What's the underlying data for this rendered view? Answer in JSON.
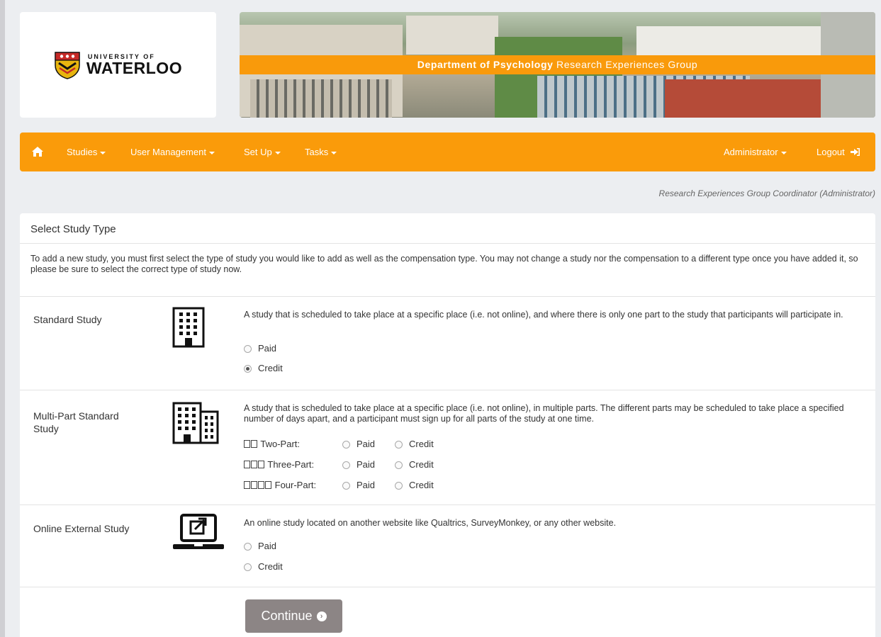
{
  "banner": {
    "logo_small": "UNIVERSITY OF",
    "logo_big": "WATERLOO",
    "dept_bold": "Department of Psychology",
    "dept_rest": " Research Experiences Group"
  },
  "nav": {
    "home_icon": "home-icon",
    "items": [
      "Studies",
      "User Management",
      "Set Up",
      "Tasks"
    ],
    "admin": "Administrator",
    "logout": "Logout"
  },
  "user_line": "Research Experiences Group Coordinator (Administrator)",
  "panel": {
    "title": "Select Study Type",
    "intro": "To add a new study, you must first select the type of study you would like to add as well as the compensation type. You may not change a study nor the compensation to a different type once you have added it, so please be sure to select the correct type of study now."
  },
  "studies": {
    "standard": {
      "title": "Standard Study",
      "icon": "building-icon",
      "desc": "A study that is scheduled to take place at a specific place (i.e. not online), and where there is only one part to the study that participants will participate in.",
      "paid": "Paid",
      "credit": "Credit",
      "selected": "Credit"
    },
    "multipart": {
      "title": "Multi-Part Standard Study",
      "icon": "buildings-icon",
      "desc": "A study that is scheduled to take place at a specific place (i.e. not online), in multiple parts. The different parts may be scheduled to take place a specified number of days apart, and a participant must sign up for all parts of the study at one time.",
      "parts": [
        {
          "label": "Two-Part:",
          "paid": "Paid",
          "credit": "Credit"
        },
        {
          "label": "Three-Part:",
          "paid": "Paid",
          "credit": "Credit"
        },
        {
          "label": "Four-Part:",
          "paid": "Paid",
          "credit": "Credit"
        }
      ]
    },
    "online": {
      "title": "Online External Study",
      "icon": "laptop-external-link-icon",
      "desc": "An online study located on another website like Qualtrics, SurveyMonkey, or any other website.",
      "paid": "Paid",
      "credit": "Credit"
    }
  },
  "continue_label": "Continue",
  "colors": {
    "accent": "#fa9b0a",
    "button": "#8c8585"
  }
}
